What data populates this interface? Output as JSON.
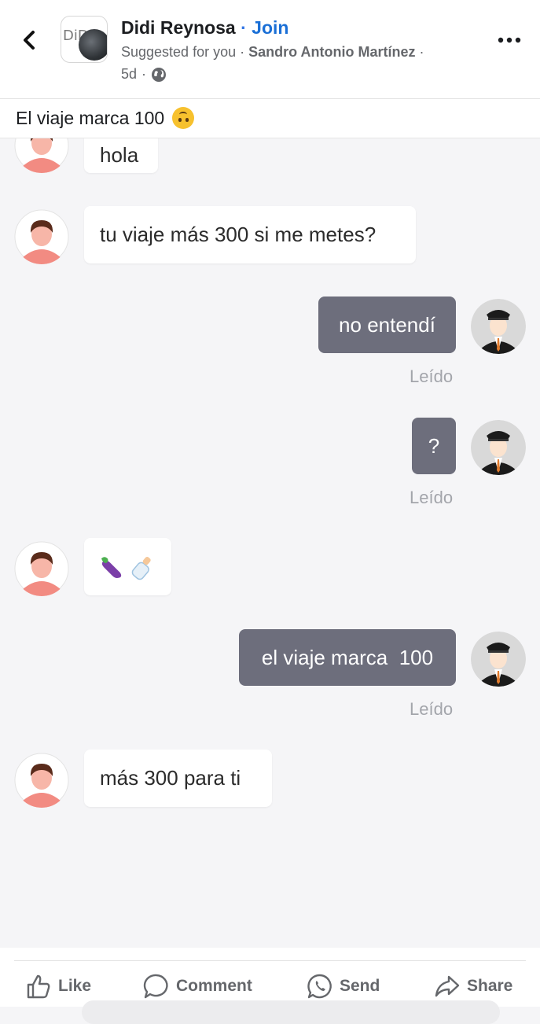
{
  "header": {
    "group_logo_text": "DiDi",
    "title": "Didi Reynosa",
    "separator": "·",
    "join_label": "Join",
    "suggested": "Suggested for you",
    "dot": "·",
    "author": "Sandro Antonio Martínez",
    "trailing_dot": "·",
    "age": "5d",
    "age_dot": "·",
    "icons": {
      "back": "back-chevron-icon",
      "privacy": "globe-icon",
      "more": "more-options-icon"
    }
  },
  "post": {
    "caption": "El viaje marca 100",
    "caption_emoji": "upside-down-face-emoji"
  },
  "chat": {
    "messages": [
      {
        "sender": "passenger",
        "text": "hola"
      },
      {
        "sender": "passenger",
        "text": "tu viaje más 300 si me metes?"
      },
      {
        "sender": "driver",
        "text": "no entendí",
        "status": "Leído"
      },
      {
        "sender": "driver",
        "text": "?",
        "status": "Leído"
      },
      {
        "sender": "passenger",
        "text": "",
        "emojis": [
          "eggplant-emoji",
          "baby-bottle-emoji"
        ]
      },
      {
        "sender": "driver",
        "text": "el viaje marca  100",
        "status": "Leído"
      },
      {
        "sender": "passenger",
        "text": "más 300 para ti"
      }
    ]
  },
  "footer": {
    "like_label": "Like",
    "comment_label": "Comment",
    "send_label": "Send",
    "share_label": "Share",
    "icons": {
      "like": "thumbs-up-icon",
      "comment": "comment-bubble-icon",
      "send": "whatsapp-send-icon",
      "share": "share-arrow-icon"
    }
  },
  "colors": {
    "join": "#1a6fd6",
    "driver_bubble": "#6d6e7c",
    "passenger_bubble": "#ffffff",
    "chat_bg": "#f5f5f7",
    "read_status": "#a3a5ab"
  }
}
